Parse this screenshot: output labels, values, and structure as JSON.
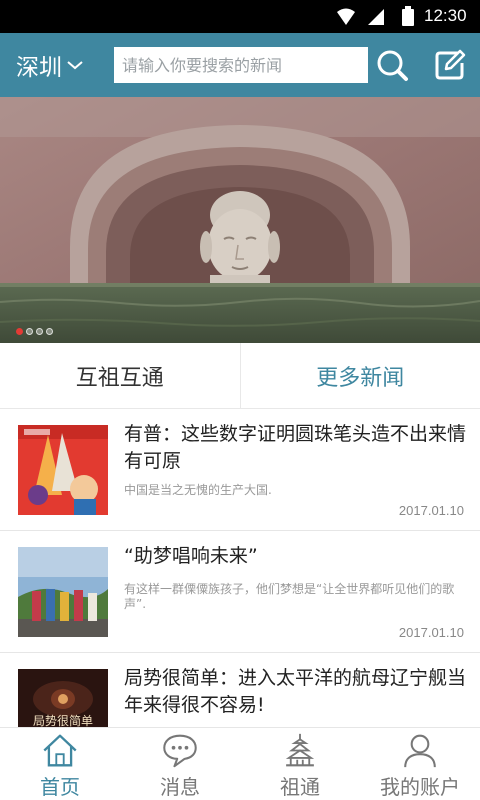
{
  "status_bar": {
    "time": "12:30"
  },
  "header": {
    "city": "深圳",
    "search_placeholder": "请输入你要搜索的新闻"
  },
  "banner": {
    "slide_count": 4,
    "active_slide": 1
  },
  "tabs": [
    {
      "label": "互祖互通"
    },
    {
      "label": "更多新闻"
    }
  ],
  "news": [
    {
      "title": "有普：这些数字证明圆珠笔头造不出来情有可原",
      "summary": "中国是当之无愧的生产大国.",
      "date": "2017.01.10"
    },
    {
      "title": "“助梦唱响未来”",
      "summary": "有这样一群傈僳族孩子，他们梦想是“让全世界都听见他们的歌声”.",
      "date": "2017.01.10"
    },
    {
      "title": "局势很简单：进入太平洋的航母辽宁舰当年来得很不容易!",
      "summary": "",
      "date": "",
      "thumb_text": "局势很简单"
    }
  ],
  "bottom_nav": [
    {
      "label": "首页",
      "icon": "home-icon",
      "active": true
    },
    {
      "label": "消息",
      "icon": "message-icon",
      "active": false
    },
    {
      "label": "祖通",
      "icon": "pagoda-icon",
      "active": false
    },
    {
      "label": "我的账户",
      "icon": "user-icon",
      "active": false
    }
  ],
  "colors": {
    "header": "#3f87a0",
    "accent": "#3f87a0",
    "dot_active": "#e43b35"
  }
}
